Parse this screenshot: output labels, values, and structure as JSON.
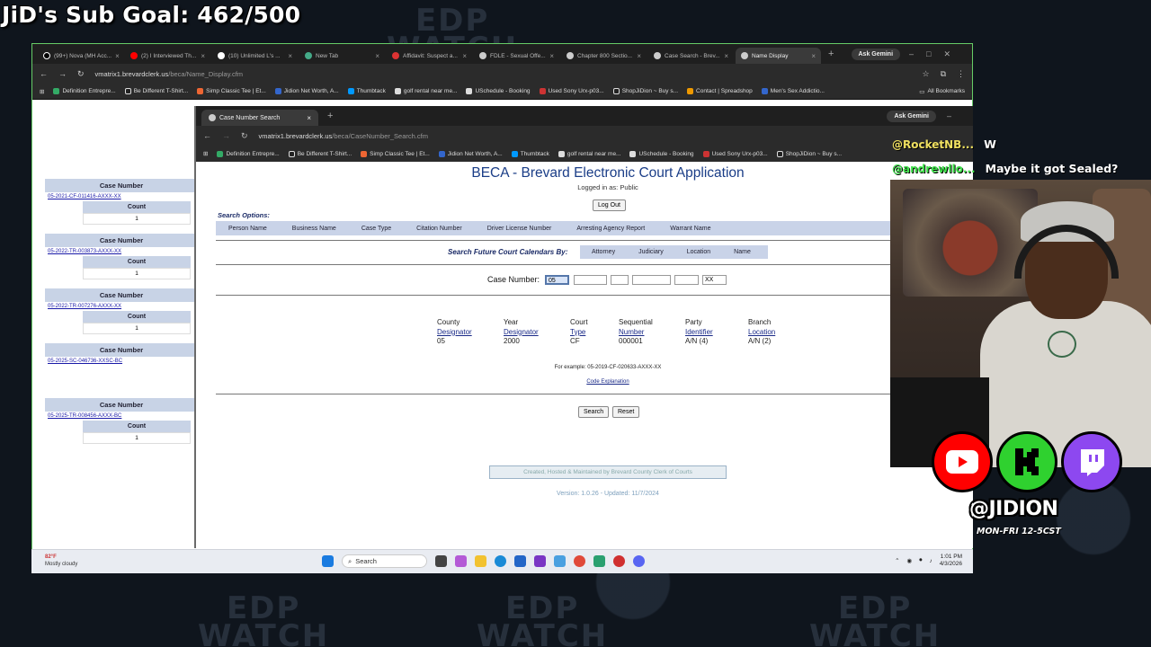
{
  "overlay": {
    "sub_goal": "JiD's Sub Goal: 462/500",
    "watermark": "EDP\nWATCH",
    "chat": [
      {
        "user": "@RocketNB...",
        "msg": "W",
        "color": "#f0e060"
      },
      {
        "user": "@andrewllo...",
        "msg": "Maybe it got Sealed?",
        "color": "#3fe04a"
      }
    ],
    "handle": "@JIDION",
    "schedule": "MON-FRI 12-5CST",
    "colors": {
      "youtube": "#ff0000",
      "kick": "#2fd12f",
      "twitch": "#8d48f0"
    }
  },
  "back_browser": {
    "tabs": [
      {
        "label": "(99+) Nova (MH Acc...",
        "icon": "tiktok-icon"
      },
      {
        "label": "(2) I Interviewed Th...",
        "icon": "youtube-icon"
      },
      {
        "label": "(10) Unlimited L's ...",
        "icon": "x-icon"
      },
      {
        "label": "New Tab",
        "icon": "chrome-icon"
      },
      {
        "label": "Affidavit: Suspect a...",
        "icon": "doc-icon"
      },
      {
        "label": "FDLE - Sexual Offe...",
        "icon": "globe-icon"
      },
      {
        "label": "Chapter 800 Sectio...",
        "icon": "globe-icon"
      },
      {
        "label": "Case Search - Brev...",
        "icon": "globe-icon"
      },
      {
        "label": "Name Display",
        "icon": "globe-icon"
      }
    ],
    "ask_gemini": "Ask Gemini",
    "url_host": "vmatrix1.brevardclerk.us",
    "url_path": "/beca/Name_Display.cfm",
    "bookmarks": [
      "Definition Entrepre...",
      "Be Different T-Shirt...",
      "Simp Classic Tee | Et...",
      "Jidion Net Worth, A...",
      "Thumbtack",
      "golf rental near me...",
      "USchedule - Booking",
      "Used Sony Urx-p03...",
      "ShopJiDion ~ Buy s...",
      "Contact | Spreadshop",
      "Men's Sex Addictio..."
    ],
    "all_bookmarks": "All Bookmarks",
    "cases": [
      {
        "header": "Case Number",
        "link": "05-2021-CF-011416-AXXX-XX",
        "count_label": "Count",
        "count": "1",
        "side": "DA"
      },
      {
        "header": "Case Number",
        "link": "05-2022-TR-003873-AXXX-XX",
        "count_label": "Count",
        "count": "1",
        "side": "DA"
      },
      {
        "header": "Case Number",
        "link": "05-2022-TR-007276-AXXX-XX",
        "count_label": "Count",
        "count": "1",
        "side": "DA"
      },
      {
        "header": "Case Number",
        "link": "05-2025-SC-046736-XXSC-BC",
        "side": "DA"
      },
      {
        "header": "Case Number",
        "link": "05-2025-TR-008456-AXXX-BC",
        "count_label": "Count",
        "count": "1",
        "side": "DA"
      }
    ]
  },
  "front_browser": {
    "tab_label": "Case Number Search",
    "ask_gemini": "Ask Gemini",
    "url_host": "vmatrix1.brevardclerk.us",
    "url_path": "/beca/CaseNumber_Search.cfm",
    "bookmarks": [
      "Definition Entrepre...",
      "Be Different T-Shirt...",
      "Simp Classic Tee | Et...",
      "Jidion Net Worth, A...",
      "Thumbtack",
      "golf rental near me...",
      "USchedule - Booking",
      "Used Sony Urx-p03...",
      "ShopJiDion ~ Buy s..."
    ]
  },
  "beca": {
    "title": "BECA - Brevard Electronic Court Application",
    "logged_in": "Logged in as: Public",
    "logout": "Log Out",
    "search_options_label": "Search Options:",
    "search_options": [
      "Person Name",
      "Business Name",
      "Case Type",
      "Citation Number",
      "Driver License Number",
      "Arresting Agency Report",
      "Warrant Name"
    ],
    "future_label": "Search Future Court Calendars By:",
    "future_options": [
      "Attorney",
      "Judiciary",
      "Location",
      "Name"
    ],
    "case_number_label": "Case Number:",
    "inputs": [
      "05",
      "",
      "",
      "",
      "",
      "XX"
    ],
    "legend": [
      {
        "l1": "County",
        "l2": "Designator",
        "v": "05"
      },
      {
        "l1": "Year",
        "l2": "Designator",
        "v": "2000"
      },
      {
        "l1": "Court",
        "l2": "Type",
        "v": "CF"
      },
      {
        "l1": "Sequential",
        "l2": "Number",
        "v": "000001"
      },
      {
        "l1": "Party",
        "l2": "Identifier",
        "v": "A/N (4)"
      },
      {
        "l1": "Branch",
        "l2": "Location",
        "v": "A/N (2)"
      }
    ],
    "example": "For example: 05-2019-CF-020633-AXXX-XX",
    "code_explanation": "Code Explanation",
    "search_btn": "Search",
    "reset_btn": "Reset",
    "footer": "Created, Hosted & Maintained by Brevard County Clerk of Courts",
    "version": "Version: 1.0.26 - Updated: 11/7/2024"
  },
  "taskbar": {
    "temp": "82°F",
    "weather": "Mostly cloudy",
    "search": "Search",
    "time": "1:01 PM",
    "date": "4/3/2026"
  }
}
